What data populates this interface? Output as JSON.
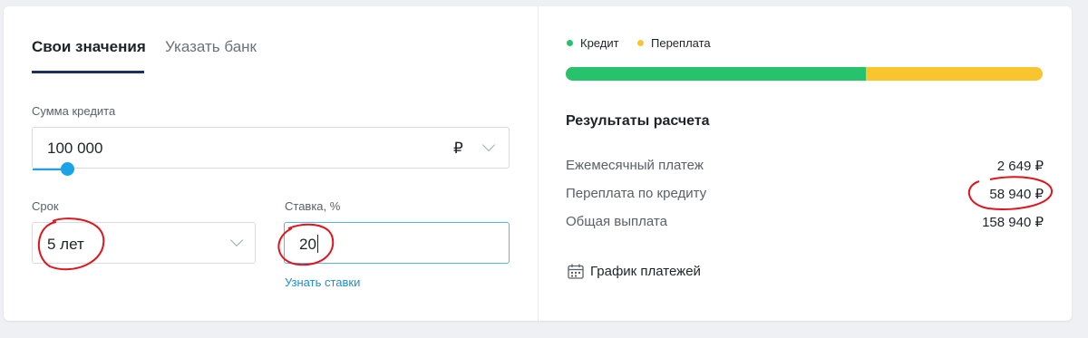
{
  "tabs": [
    {
      "label": "Свои значения"
    },
    {
      "label": "Указать банк"
    }
  ],
  "loan_amount": {
    "label": "Сумма кредита",
    "value": "100 000",
    "currency": "₽",
    "slider_level": 0.06
  },
  "term": {
    "label": "Срок",
    "value": "5 лет"
  },
  "rate": {
    "label": "Ставка, %",
    "value": "20",
    "link": "Узнать ставки"
  },
  "legend": [
    {
      "label": "Кредит",
      "color": "#27c26c"
    },
    {
      "label": "Переплата",
      "color": "#f8c52e"
    }
  ],
  "breakdown": {
    "credit_share": 0.629,
    "overpay_share": 0.371
  },
  "results": {
    "title": "Результаты расчета",
    "rows": [
      {
        "label": "Ежемесячный платеж",
        "value": "2 649 ₽"
      },
      {
        "label": "Переплата по кредиту",
        "value": "58 940 ₽"
      },
      {
        "label": "Общая выплата",
        "value": "158 940 ₽"
      }
    ],
    "schedule_label": "График платежей"
  },
  "colors": {
    "accent": "#1aa3e8",
    "annotation": "#e0141c"
  }
}
